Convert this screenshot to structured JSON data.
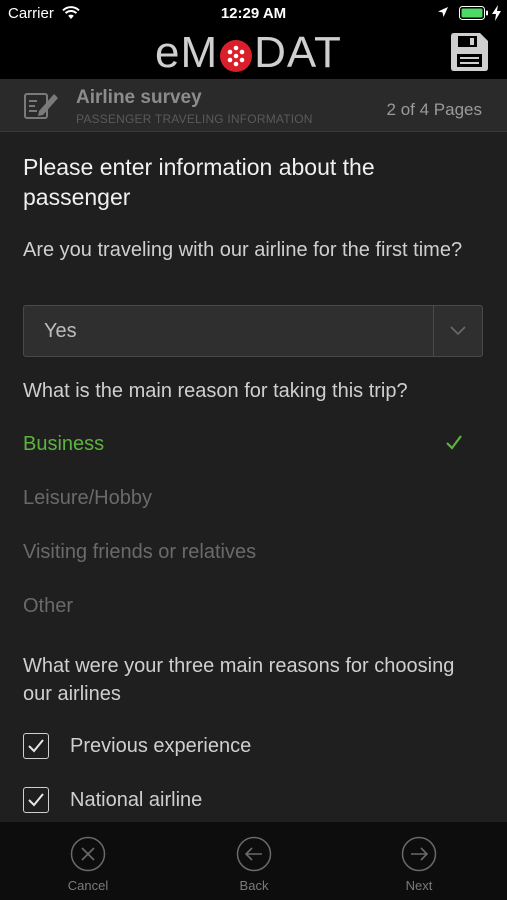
{
  "status_bar": {
    "carrier": "Carrier",
    "time": "12:29 AM",
    "battery_color": "#4cd964"
  },
  "app": {
    "logo_left": "eM",
    "logo_right": "DAT",
    "logo_accent": "#e0202a"
  },
  "survey": {
    "title": "Airline survey",
    "subtitle": "PASSENGER TRAVELING INFORMATION",
    "pages": "2 of 4 Pages"
  },
  "form": {
    "heading": "Please enter information about the passenger",
    "q1": {
      "label": "Are you traveling with our airline for the first time?",
      "value": "Yes"
    },
    "q2": {
      "label": "What is the main reason for taking this trip?",
      "options": [
        "Business",
        "Leisure/Hobby",
        "Visiting friends or relatives",
        "Other"
      ],
      "selected": "Business",
      "selected_color": "#5db33f"
    },
    "q3": {
      "label": "What were your three main reasons for choosing our airlines",
      "checkboxes": [
        {
          "label": "Previous experience",
          "checked": true
        },
        {
          "label": "National airline",
          "checked": true
        }
      ]
    }
  },
  "bottom_bar": {
    "cancel": "Cancel",
    "back": "Back",
    "next": "Next"
  }
}
